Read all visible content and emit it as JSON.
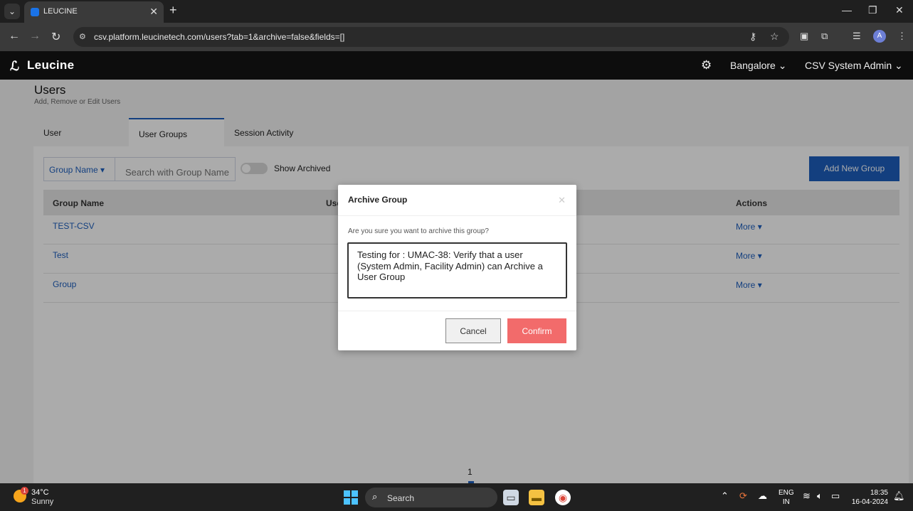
{
  "browser": {
    "tab_title": "LEUCINE",
    "url": "csv.platform.leucinetech.com/users?tab=1&archive=false&fields=[]",
    "profile_initial": "A"
  },
  "header": {
    "brand": "Leucine",
    "facility": "Bangalore",
    "user": "CSV System Admin"
  },
  "page": {
    "title": "Users",
    "subtitle": "Add, Remove or Edit Users",
    "tabs": [
      {
        "label": "User",
        "active": false
      },
      {
        "label": "User Groups",
        "active": true
      },
      {
        "label": "Session Activity",
        "active": false
      }
    ]
  },
  "toolbar": {
    "filter_field": "Group Name",
    "search_placeholder": "Search with Group Name",
    "show_archived_label": "Show Archived",
    "add_button": "Add New Group"
  },
  "table": {
    "columns": [
      "Group Name",
      "Use",
      "Actions"
    ],
    "rows": [
      {
        "name": "TEST-CSV",
        "action": "More"
      },
      {
        "name": "Test",
        "action": "More"
      },
      {
        "name": "Group",
        "action": "More"
      }
    ]
  },
  "pagination": {
    "current": "1"
  },
  "modal": {
    "title": "Archive Group",
    "question": "Are you sure you want to archive this group?",
    "reason_value": "Testing for : UMAC-38: Verify that a user (System Admin, Facility Admin) can Archive a User Group",
    "cancel": "Cancel",
    "confirm": "Confirm"
  },
  "taskbar": {
    "weather_badge": "1",
    "temp": "34°C",
    "condition": "Sunny",
    "search": "Search",
    "lang_top": "ENG",
    "lang_bottom": "IN",
    "time": "18:35",
    "date": "16-04-2024"
  },
  "colors": {
    "accent": "#1d5fbe",
    "confirm": "#f26b6b",
    "header_bg": "#0d0d0d"
  }
}
